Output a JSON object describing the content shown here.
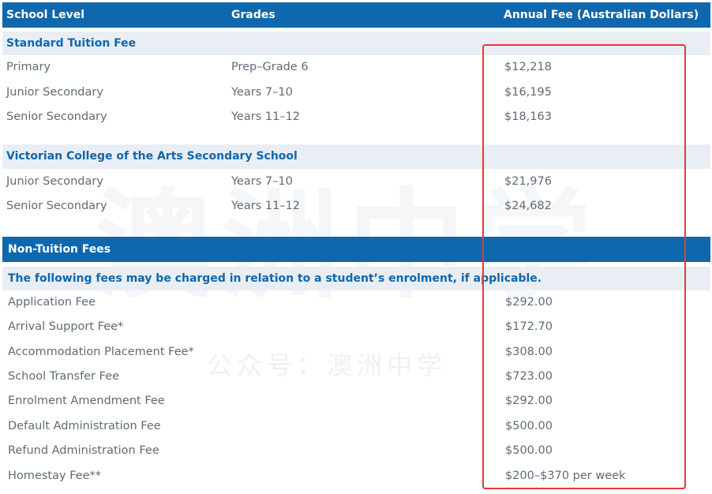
{
  "header": {
    "col_level": "School Level",
    "col_grades": "Grades",
    "col_fee": "Annual Fee (Australian Dollars)"
  },
  "standard": {
    "title": "Standard Tuition Fee",
    "rows": [
      {
        "level": "Primary",
        "grades": "Prep–Grade 6",
        "fee": "$12,218"
      },
      {
        "level": "Junior Secondary",
        "grades": "Years 7–10",
        "fee": "$16,195"
      },
      {
        "level": "Senior Secondary",
        "grades": "Years 11–12",
        "fee": "$18,163"
      }
    ]
  },
  "vca": {
    "title": "Victorian College of the Arts Secondary School",
    "rows": [
      {
        "level": "Junior Secondary",
        "grades": "Years 7–10",
        "fee": "$21,976"
      },
      {
        "level": "Senior Secondary",
        "grades": "Years 11–12",
        "fee": "$24,682"
      }
    ]
  },
  "non_tuition": {
    "title": "Non-Tuition Fees",
    "note": "The following fees may be charged in relation to a student’s enrolment, if applicable.",
    "rows": [
      {
        "label": "Application Fee",
        "fee": "$292.00"
      },
      {
        "label": "Arrival Support Fee*",
        "fee": "$172.70"
      },
      {
        "label": "Accommodation Placement Fee*",
        "fee": "$308.00"
      },
      {
        "label": "School Transfer Fee",
        "fee": "$723.00"
      },
      {
        "label": "Enrolment Amendment Fee",
        "fee": "$292.00"
      },
      {
        "label": "Default Administration Fee",
        "fee": "$500.00"
      },
      {
        "label": "Refund Administration Fee",
        "fee": "$500.00"
      },
      {
        "label": "Homestay Fee**",
        "fee": "$200–$370 per week"
      }
    ]
  },
  "watermark": {
    "text": "公众号：澳洲中学",
    "big": "澳洲中学"
  },
  "colors": {
    "header_blue": "#0f67ad",
    "section_bg": "#e9eef5",
    "highlight_red": "#e53935"
  }
}
